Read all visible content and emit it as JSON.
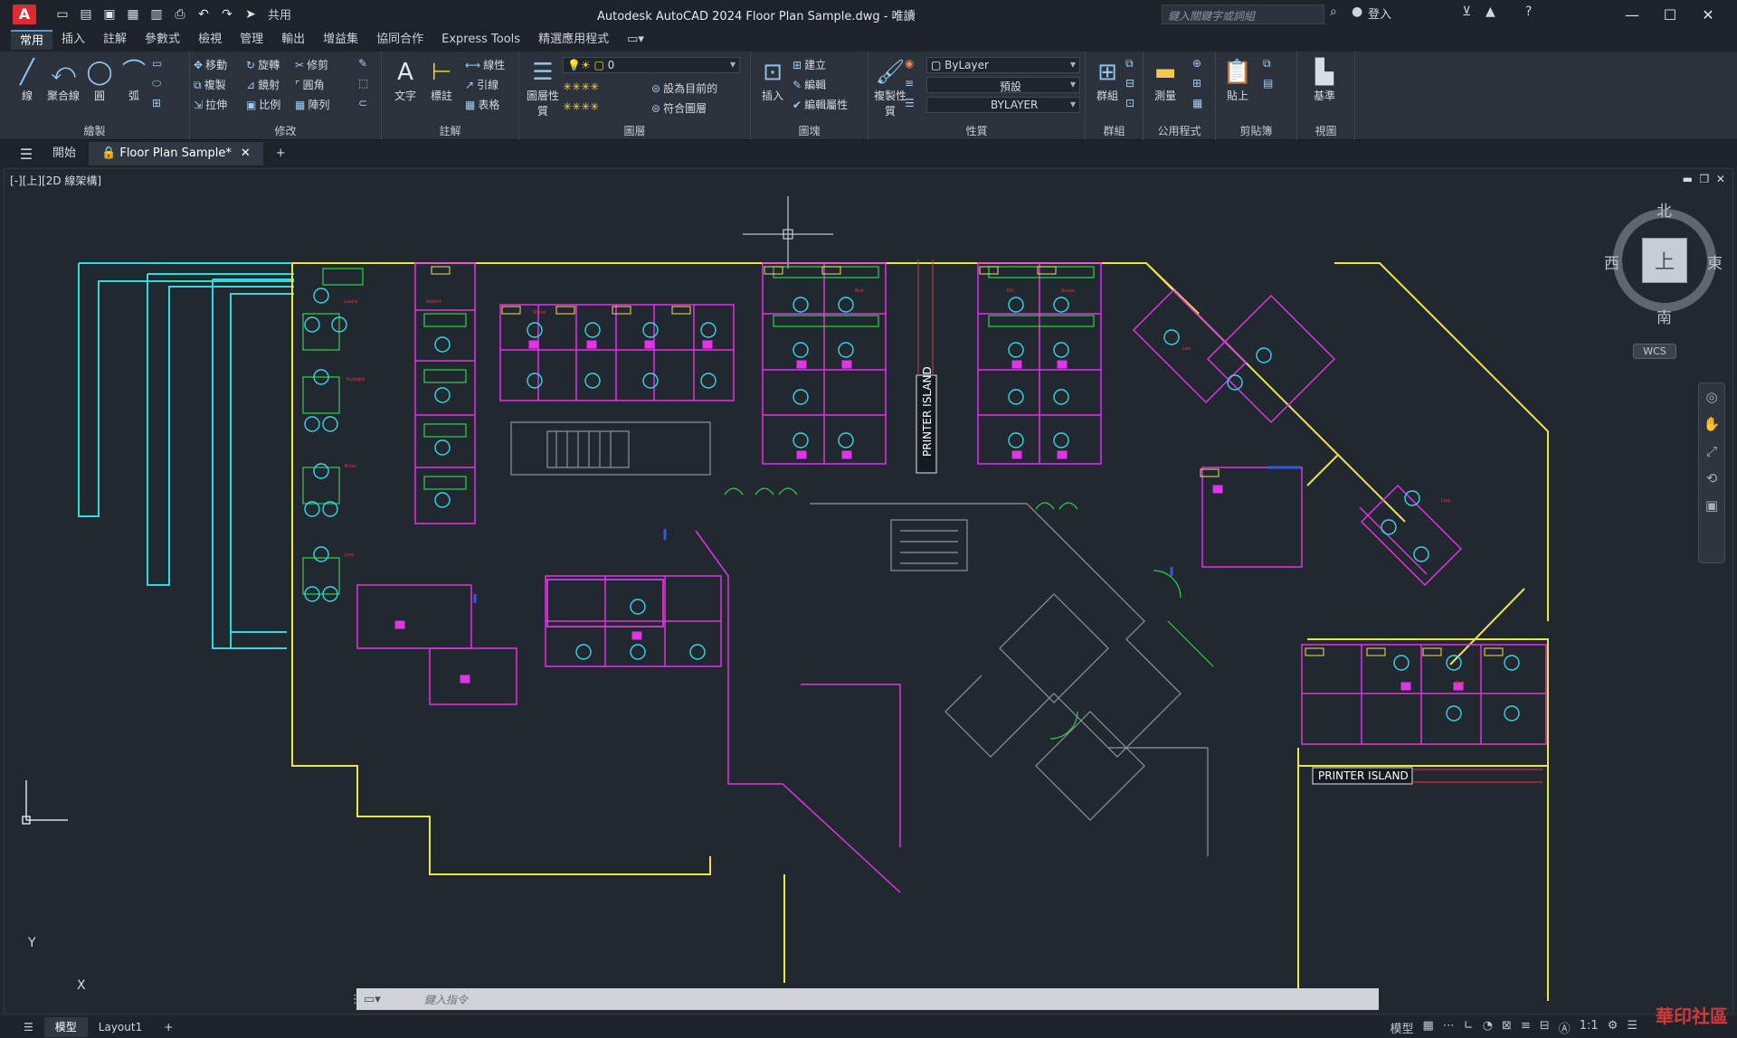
{
  "titlebar": {
    "app_letter": "A",
    "share_label": "共用",
    "title": "Autodesk AutoCAD 2024   Floor Plan Sample.dwg - 唯讀",
    "search_placeholder": "鍵入關鍵字或詞組",
    "signin_label": "登入"
  },
  "ribbon_tabs": [
    "常用",
    "插入",
    "註解",
    "參數式",
    "檢視",
    "管理",
    "輸出",
    "增益集",
    "協同合作",
    "Express Tools",
    "精選應用程式"
  ],
  "ribbon": {
    "draw": {
      "title": "繪製",
      "line": "線",
      "polyline": "聚合線",
      "circle": "圓",
      "arc": "弧"
    },
    "modify": {
      "title": "修改",
      "move": "移動",
      "rotate": "旋轉",
      "trim": "修剪",
      "copy": "複製",
      "mirror": "鏡射",
      "fillet": "圓角",
      "stretch": "拉伸",
      "scale": "比例",
      "array": "陣列"
    },
    "annotation": {
      "title": "註解",
      "text": "文字",
      "dimension": "標註",
      "linear": "線性",
      "leader": "引線",
      "table": "表格"
    },
    "layers": {
      "title": "圖層",
      "layer_props": "圖層性質",
      "current_layer": "0",
      "set_current": "設為目前的",
      "match_layer": "符合圖層"
    },
    "block": {
      "title": "圖塊",
      "insert": "插入",
      "create": "建立",
      "edit": "編輯",
      "edit_attributes": "編輯屬性"
    },
    "properties": {
      "title": "性質",
      "match_props": "複製性質",
      "color": "ByLayer",
      "linetype": "預設",
      "lineweight": "BYLAYER"
    },
    "groups": {
      "title": "群組",
      "group": "群組"
    },
    "utilities": {
      "title": "公用程式",
      "measure": "測量"
    },
    "clipboard": {
      "title": "剪貼簿",
      "paste": "貼上"
    },
    "view": {
      "title": "視圖",
      "base": "基準"
    }
  },
  "doc_tabs": {
    "start": "開始",
    "file": "Floor Plan Sample*"
  },
  "viewport": {
    "label": "[-][上][2D 線架構]",
    "printer_island_1": "PRINTER ISLAND",
    "printer_island_2": "PRINTER  ISLAND"
  },
  "viewcube": {
    "north": "北",
    "south": "南",
    "east": "東",
    "west": "西",
    "face": "上",
    "wcs": "WCS"
  },
  "ucs": {
    "x": "X",
    "y": "Y"
  },
  "command": {
    "placeholder": "鍵入指令"
  },
  "statusbar": {
    "model": "模型",
    "layout1": "Layout1",
    "model_label": "模型",
    "scale": "1:1"
  },
  "watermark": "華印社區"
}
